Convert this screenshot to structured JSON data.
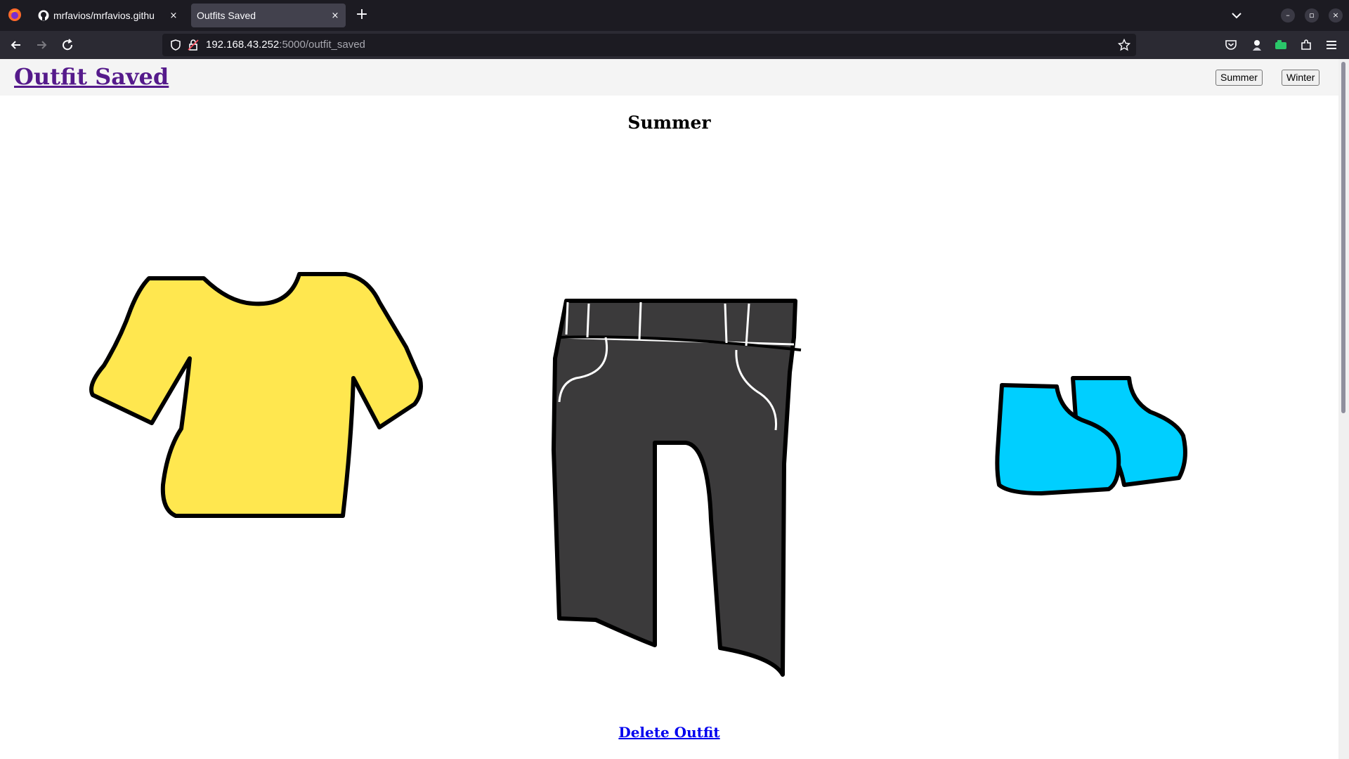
{
  "browser": {
    "tabs": [
      {
        "title": "mrfavios/mrfavios.githu",
        "close": "×"
      },
      {
        "title": "Outfits Saved",
        "close": "×"
      }
    ],
    "new_tab": "+",
    "window_controls": {
      "minimize": "–",
      "restore": "▫",
      "close": "×"
    },
    "url": {
      "host": "192.168.43.252",
      "rest": ":5000/outfit_saved"
    },
    "accent_color": "#1c1b22"
  },
  "page": {
    "title": "Outfit Saved",
    "buttons": {
      "summer": "Summer",
      "winter": "Winter"
    },
    "season_heading": "Summer",
    "items": [
      {
        "name": "shirt",
        "color": "#ffe74f"
      },
      {
        "name": "pants",
        "color": "#3b3a3b"
      },
      {
        "name": "shoes",
        "color": "#00cfff"
      }
    ],
    "delete_label": "Delete Outfit",
    "link_color": "#551a8b"
  }
}
